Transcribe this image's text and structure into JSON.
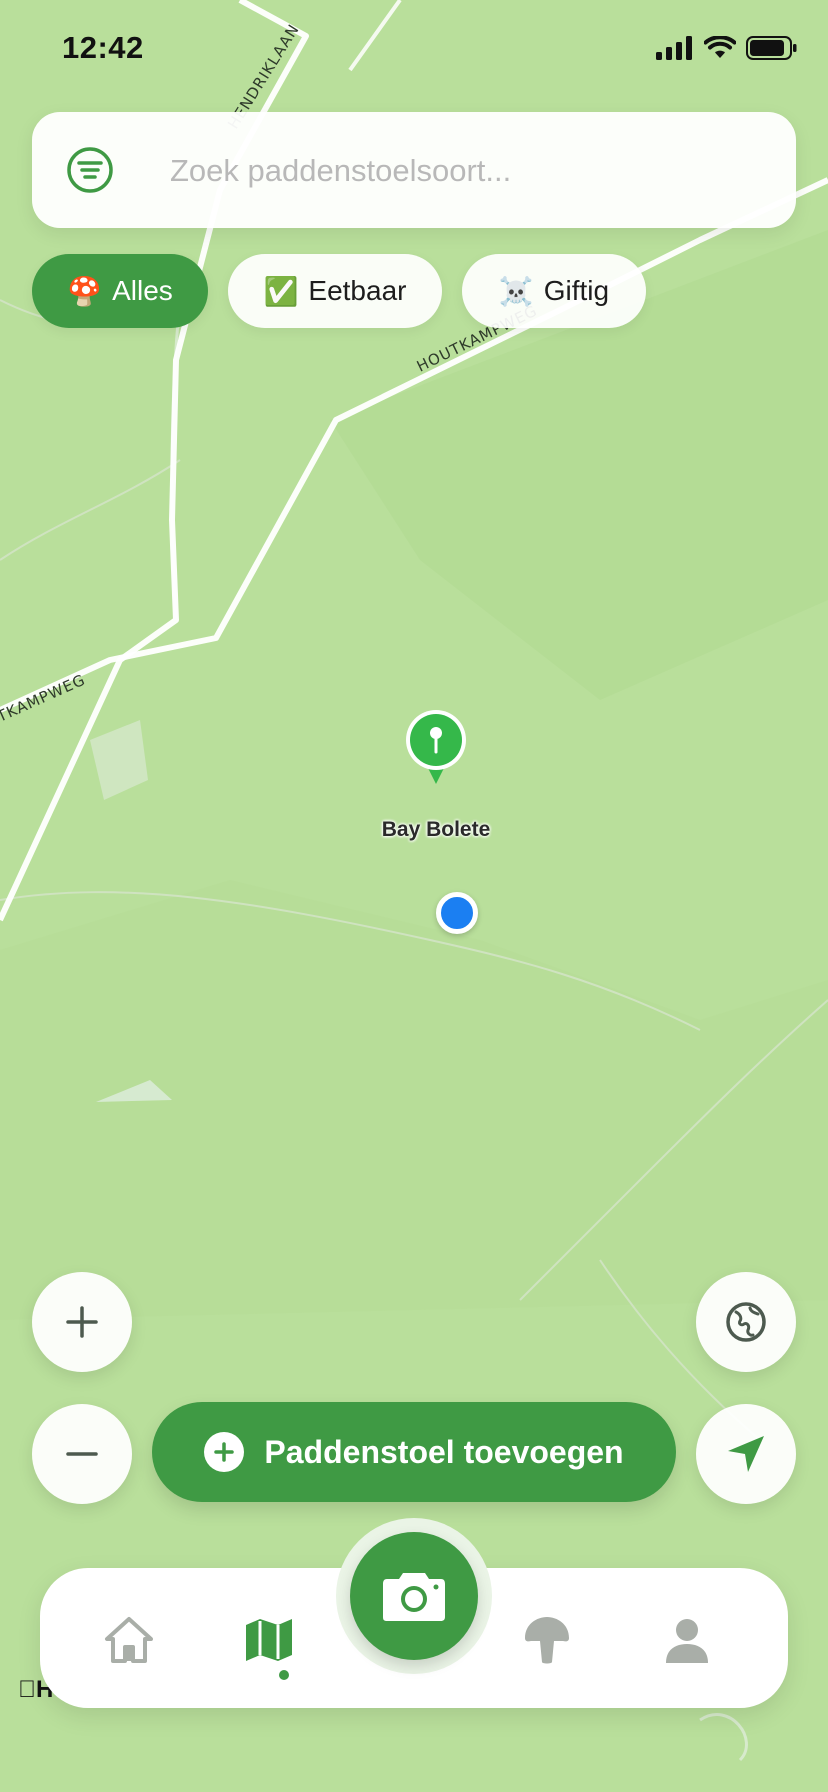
{
  "status_bar": {
    "time": "12:42"
  },
  "search": {
    "placeholder": "Zoek paddenstoelsoort..."
  },
  "filters": [
    {
      "emoji": "🍄",
      "label": "Alles",
      "active": true
    },
    {
      "emoji": "✅",
      "label": "Eetbaar",
      "active": false
    },
    {
      "emoji": "☠️",
      "label": "Giftig",
      "active": false
    }
  ],
  "map": {
    "street_labels": [
      "HENDRIKLAAN",
      "HOUTKAMPWEG",
      "TKAMPWEG"
    ],
    "pin": {
      "label": "Bay Bolete"
    },
    "attribution": "Ho"
  },
  "actions": {
    "add_label": "Paddenstoel toevoegen"
  },
  "tabbar": {
    "active_tab": "map"
  },
  "colors": {
    "accent": "#3f9a44",
    "map_bg": "#b9df9b",
    "user_location": "#1b7ff2",
    "pin": "#35b84a"
  }
}
